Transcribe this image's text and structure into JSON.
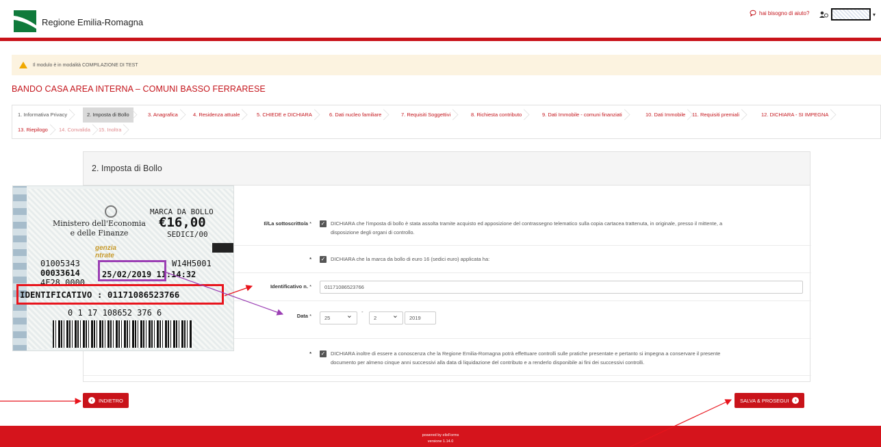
{
  "header": {
    "brand": "Regione Emilia-Romagna",
    "help_label": "hai bisogno di aiuto?",
    "accent": "#c9131a"
  },
  "warning": {
    "text": "Il modulo è in modalità COMPILAZIONE DI TEST"
  },
  "page_title": "BANDO CASA AREA INTERNA – COMUNI BASSO FERRARESE",
  "tabs": [
    {
      "label": "1. Informativa Privacy",
      "state": "done"
    },
    {
      "label": "2. Imposta di Bollo",
      "state": "active"
    },
    {
      "label": "3. Anagrafica",
      "state": "todo"
    },
    {
      "label": "4. Residenza attuale",
      "state": "todo"
    },
    {
      "label": "5. CHIEDE e DICHIARA",
      "state": "todo"
    },
    {
      "label": "6. Dati nucleo familiare",
      "state": "todo"
    },
    {
      "label": "7. Requisiti Soggettivi",
      "state": "todo"
    },
    {
      "label": "8. Richiesta contributo",
      "state": "todo"
    },
    {
      "label": "9. Dati Immobile - comuni finanziati",
      "state": "todo"
    },
    {
      "label": "10. Dati Immobile",
      "state": "todo"
    },
    {
      "label": "11. Requisiti premiali",
      "state": "todo"
    },
    {
      "label": "12. DICHIARA - SI IMPEGNA",
      "state": "todo"
    },
    {
      "label": "13. Riepilogo",
      "state": "todo"
    },
    {
      "label": "14. Convalida",
      "state": "disabled"
    },
    {
      "label": "15. Inoltra",
      "state": "disabled"
    }
  ],
  "panel": {
    "title": "2. Imposta di Bollo",
    "sottoscritto_label": "Il/La sottoscritto/a",
    "required_mark": "*",
    "decl1_line1": "DICHIARA che l'imposta di bollo è stata assolta tramite acquisto ed apposizione del contrassegno telematico sulla copia cartacea trattenuta, in originale, presso il mittente, a",
    "decl1_line2": "disposizione degli organi di controllo.",
    "decl2": "DICHIARA che la marca da bollo di euro 16 (sedici euro) applicata ha:",
    "identificativo_label": "Identificativo n.",
    "identificativo_value": "01171086523766",
    "data_label": "Data",
    "day": "25",
    "month": "2",
    "year": "2019",
    "date_sep": "-",
    "decl3_line1": "DICHIARA inoltre di essere a conoscenza che la Regione Emilia-Romagna potrà effettuare controlli sulle pratiche presentate e pertanto si impegna a conservare il presente",
    "decl3_line2": "documento per almeno cinque anni successivi alla data di liquidazione del contributo e a renderlo disponibile ai fini dei successivi controlli."
  },
  "buttons": {
    "back": "INDIETRO",
    "save": "SALVA & PROSEGUI"
  },
  "footer": {
    "line1": "powered by elixForms",
    "line2": "versione 1.14.0"
  },
  "stamp": {
    "ministero_line1": "Ministero dell'Economia",
    "ministero_line2": "e delle Finanze",
    "marca": "MARCA DA BOLLO",
    "amount": "€16,00",
    "sedici": "SEDICI/00",
    "agenzia_line1": "genzia",
    "agenzia_line2": "ntrate",
    "code1": "01005343",
    "code2": "00033614",
    "code3": "4F28 0000",
    "code_right1": "W14H5001",
    "date_time": "25/02/2019 11:14:32",
    "identificativo": "IDENTIFICATIVO : 01171086523766",
    "barcode_number": "0 1 17 108652 376 6"
  }
}
